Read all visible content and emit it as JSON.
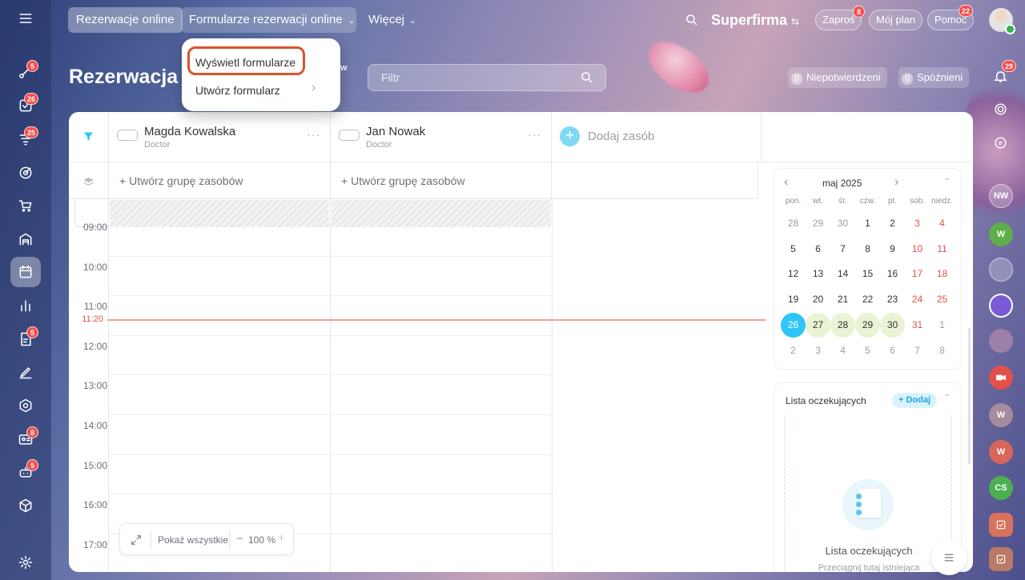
{
  "topbar": {
    "tab_booking": "Rezerwacje online",
    "tab_forms": "Formularze rezerwacji online",
    "tab_more": "Więcej",
    "company": "Superfirma",
    "invite_label": "Zaproś",
    "invite_badge": "8",
    "myplan_label": "Mój plan",
    "help_label": "Pomoc",
    "help_badge": "22"
  },
  "dropdown": {
    "view_forms": "Wyświetl formularze",
    "create_form": "Utwórz formularz"
  },
  "page": {
    "title": "Rezerwacja o",
    "title_fragment": "w",
    "filter_placeholder": "Filtr",
    "unconfirmed_count": "0",
    "unconfirmed_label": "Niepotwierdzeni",
    "late_count": "0",
    "late_label": "Spóźnieni"
  },
  "left_sidebar": {
    "badges": [
      "5",
      "26",
      "25",
      "5",
      "8",
      "5"
    ]
  },
  "resources": [
    {
      "name": "Magda Kowalska",
      "role": "Doctor",
      "group_label": "Utwórz grupę zasobów"
    },
    {
      "name": "Jan Nowak",
      "role": "Doctor",
      "group_label": "Utwórz grupę zasobów"
    }
  ],
  "add_resource_label": "Dodaj zasób",
  "hours": [
    "09:00",
    "10:00",
    "11:00",
    "12:00",
    "13:00",
    "14:00",
    "15:00",
    "16:00",
    "17:00"
  ],
  "current_time": "11:20",
  "zoom": {
    "show_all_label": "Pokaż wszystkie",
    "level": "100 %"
  },
  "calendar": {
    "month_label": "maj 2025",
    "weekdays": [
      "pon.",
      "wt.",
      "śr.",
      "czw.",
      "pt.",
      "sob.",
      "niedz."
    ],
    "weeks": [
      [
        "28",
        "29",
        "30",
        "1",
        "2",
        "3",
        "4"
      ],
      [
        "5",
        "6",
        "7",
        "8",
        "9",
        "10",
        "11"
      ],
      [
        "12",
        "13",
        "14",
        "15",
        "16",
        "17",
        "18"
      ],
      [
        "19",
        "20",
        "21",
        "22",
        "23",
        "24",
        "25"
      ],
      [
        "26",
        "27",
        "28",
        "29",
        "30",
        "31",
        "1"
      ],
      [
        "2",
        "3",
        "4",
        "5",
        "6",
        "7",
        "8"
      ]
    ],
    "today": "26",
    "accent_color": "#2fc6f6",
    "weekend_color": "#e3504b",
    "highlight_color": "#eaf3d3"
  },
  "waiting_list": {
    "title": "Lista oczekujących",
    "add_label": "+ Dodaj",
    "empty_title": "Lista oczekujących",
    "empty_hint": "Przeciągnij tutaj istniejąca"
  },
  "right_bar": {
    "notif_badge": "29",
    "avatars": [
      "NW",
      "W",
      "W",
      "W",
      "CS"
    ]
  }
}
